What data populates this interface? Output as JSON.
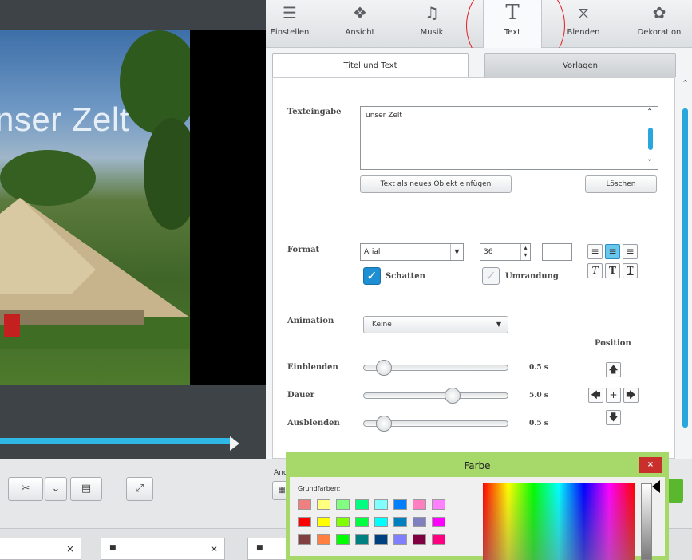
{
  "preview": {
    "overlay_text": "nser Zelt"
  },
  "tabs": [
    {
      "label": "Einstellen",
      "icon": "sliders-icon",
      "glyph": "☰"
    },
    {
      "label": "Ansicht",
      "icon": "view-icon",
      "glyph": "❖"
    },
    {
      "label": "Musik",
      "icon": "music-note-icon",
      "glyph": "♫"
    },
    {
      "label": "Text",
      "icon": "text-icon",
      "glyph": "T"
    },
    {
      "label": "Blenden",
      "icon": "transition-icon",
      "glyph": "⧖"
    },
    {
      "label": "Dekoration",
      "icon": "decoration-icon",
      "glyph": "✿"
    }
  ],
  "active_tab": "Text",
  "subtabs": {
    "active": "Titel und Text",
    "inactive": "Vorlagen"
  },
  "text_input": {
    "label": "Texteingabe",
    "value": "unser Zelt",
    "insert_button": "Text als neues Objekt einfügen",
    "delete_button": "Löschen"
  },
  "format": {
    "label": "Format",
    "font": "Arial",
    "size": "36",
    "color": "#ffffff",
    "shadow_label": "Schatten",
    "shadow_checked": true,
    "outline_label": "Umrandung",
    "outline_checked": false,
    "align_left": "≡",
    "align_center": "≡",
    "align_right": "≡",
    "italic": "T",
    "bold": "T",
    "underline": "T"
  },
  "animation": {
    "label": "Animation",
    "value": "Keine",
    "position_label": "Position",
    "sliders": [
      {
        "label": "Einblenden",
        "value": "0.5 s",
        "fraction": 0.1
      },
      {
        "label": "Dauer",
        "value": "5.0 s",
        "fraction": 0.63
      },
      {
        "label": "Ausblenden",
        "value": "0.5 s",
        "fraction": 0.1
      }
    ],
    "position_buttons": {
      "up": "🡅",
      "left": "🡄",
      "center": "+",
      "right": "🡆",
      "down": "🡇"
    }
  },
  "toolbar": {
    "anchor_text": "Anc",
    "cut_icon": "✂",
    "dropdown_icon": "⌄",
    "film_icon": "▤",
    "expand_icon": "⤢"
  },
  "timeline": {
    "slots": [
      {
        "marker": "■",
        "close": "×"
      },
      {
        "marker": "■",
        "close": "×"
      },
      {
        "marker": "■",
        "close": ""
      }
    ]
  },
  "color_dialog": {
    "title": "Farbe",
    "close": "×",
    "basic_colors_label": "Grundfarben:",
    "swatches": [
      [
        "#f08080",
        "#ffff80",
        "#80ff80",
        "#00ff80",
        "#80ffff",
        "#0080ff",
        "#ff80c0",
        "#ff80ff"
      ],
      [
        "#ff0000",
        "#ffff00",
        "#80ff00",
        "#00ff40",
        "#00ffff",
        "#0080c0",
        "#8080c0",
        "#ff00ff"
      ],
      [
        "#804040",
        "#ff8040",
        "#00ff00",
        "#008080",
        "#004080",
        "#8080ff",
        "#800040",
        "#ff0080"
      ]
    ]
  },
  "colors": {
    "accent": "#2aa6df",
    "dialog_border": "#a6d96a",
    "highlight": "#e31e24"
  }
}
